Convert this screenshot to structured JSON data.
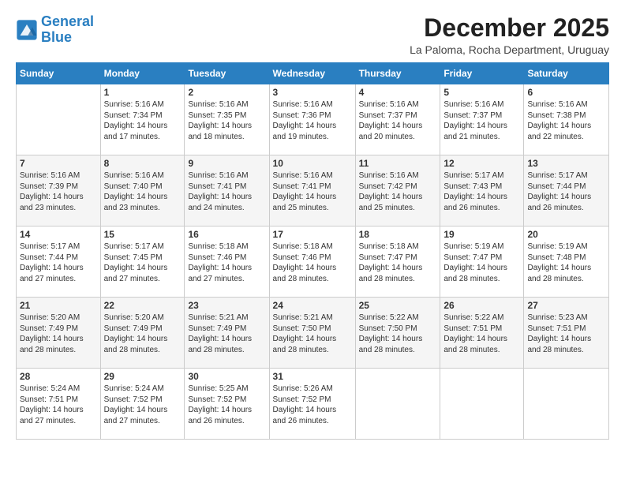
{
  "logo": {
    "line1": "General",
    "line2": "Blue"
  },
  "title": "December 2025",
  "subtitle": "La Paloma, Rocha Department, Uruguay",
  "days_header": [
    "Sunday",
    "Monday",
    "Tuesday",
    "Wednesday",
    "Thursday",
    "Friday",
    "Saturday"
  ],
  "weeks": [
    [
      {
        "day": "",
        "info": ""
      },
      {
        "day": "1",
        "info": "Sunrise: 5:16 AM\nSunset: 7:34 PM\nDaylight: 14 hours\nand 17 minutes."
      },
      {
        "day": "2",
        "info": "Sunrise: 5:16 AM\nSunset: 7:35 PM\nDaylight: 14 hours\nand 18 minutes."
      },
      {
        "day": "3",
        "info": "Sunrise: 5:16 AM\nSunset: 7:36 PM\nDaylight: 14 hours\nand 19 minutes."
      },
      {
        "day": "4",
        "info": "Sunrise: 5:16 AM\nSunset: 7:37 PM\nDaylight: 14 hours\nand 20 minutes."
      },
      {
        "day": "5",
        "info": "Sunrise: 5:16 AM\nSunset: 7:37 PM\nDaylight: 14 hours\nand 21 minutes."
      },
      {
        "day": "6",
        "info": "Sunrise: 5:16 AM\nSunset: 7:38 PM\nDaylight: 14 hours\nand 22 minutes."
      }
    ],
    [
      {
        "day": "7",
        "info": "Sunrise: 5:16 AM\nSunset: 7:39 PM\nDaylight: 14 hours\nand 23 minutes."
      },
      {
        "day": "8",
        "info": "Sunrise: 5:16 AM\nSunset: 7:40 PM\nDaylight: 14 hours\nand 23 minutes."
      },
      {
        "day": "9",
        "info": "Sunrise: 5:16 AM\nSunset: 7:41 PM\nDaylight: 14 hours\nand 24 minutes."
      },
      {
        "day": "10",
        "info": "Sunrise: 5:16 AM\nSunset: 7:41 PM\nDaylight: 14 hours\nand 25 minutes."
      },
      {
        "day": "11",
        "info": "Sunrise: 5:16 AM\nSunset: 7:42 PM\nDaylight: 14 hours\nand 25 minutes."
      },
      {
        "day": "12",
        "info": "Sunrise: 5:17 AM\nSunset: 7:43 PM\nDaylight: 14 hours\nand 26 minutes."
      },
      {
        "day": "13",
        "info": "Sunrise: 5:17 AM\nSunset: 7:44 PM\nDaylight: 14 hours\nand 26 minutes."
      }
    ],
    [
      {
        "day": "14",
        "info": "Sunrise: 5:17 AM\nSunset: 7:44 PM\nDaylight: 14 hours\nand 27 minutes."
      },
      {
        "day": "15",
        "info": "Sunrise: 5:17 AM\nSunset: 7:45 PM\nDaylight: 14 hours\nand 27 minutes."
      },
      {
        "day": "16",
        "info": "Sunrise: 5:18 AM\nSunset: 7:46 PM\nDaylight: 14 hours\nand 27 minutes."
      },
      {
        "day": "17",
        "info": "Sunrise: 5:18 AM\nSunset: 7:46 PM\nDaylight: 14 hours\nand 28 minutes."
      },
      {
        "day": "18",
        "info": "Sunrise: 5:18 AM\nSunset: 7:47 PM\nDaylight: 14 hours\nand 28 minutes."
      },
      {
        "day": "19",
        "info": "Sunrise: 5:19 AM\nSunset: 7:47 PM\nDaylight: 14 hours\nand 28 minutes."
      },
      {
        "day": "20",
        "info": "Sunrise: 5:19 AM\nSunset: 7:48 PM\nDaylight: 14 hours\nand 28 minutes."
      }
    ],
    [
      {
        "day": "21",
        "info": "Sunrise: 5:20 AM\nSunset: 7:49 PM\nDaylight: 14 hours\nand 28 minutes."
      },
      {
        "day": "22",
        "info": "Sunrise: 5:20 AM\nSunset: 7:49 PM\nDaylight: 14 hours\nand 28 minutes."
      },
      {
        "day": "23",
        "info": "Sunrise: 5:21 AM\nSunset: 7:49 PM\nDaylight: 14 hours\nand 28 minutes."
      },
      {
        "day": "24",
        "info": "Sunrise: 5:21 AM\nSunset: 7:50 PM\nDaylight: 14 hours\nand 28 minutes."
      },
      {
        "day": "25",
        "info": "Sunrise: 5:22 AM\nSunset: 7:50 PM\nDaylight: 14 hours\nand 28 minutes."
      },
      {
        "day": "26",
        "info": "Sunrise: 5:22 AM\nSunset: 7:51 PM\nDaylight: 14 hours\nand 28 minutes."
      },
      {
        "day": "27",
        "info": "Sunrise: 5:23 AM\nSunset: 7:51 PM\nDaylight: 14 hours\nand 28 minutes."
      }
    ],
    [
      {
        "day": "28",
        "info": "Sunrise: 5:24 AM\nSunset: 7:51 PM\nDaylight: 14 hours\nand 27 minutes."
      },
      {
        "day": "29",
        "info": "Sunrise: 5:24 AM\nSunset: 7:52 PM\nDaylight: 14 hours\nand 27 minutes."
      },
      {
        "day": "30",
        "info": "Sunrise: 5:25 AM\nSunset: 7:52 PM\nDaylight: 14 hours\nand 26 minutes."
      },
      {
        "day": "31",
        "info": "Sunrise: 5:26 AM\nSunset: 7:52 PM\nDaylight: 14 hours\nand 26 minutes."
      },
      {
        "day": "",
        "info": ""
      },
      {
        "day": "",
        "info": ""
      },
      {
        "day": "",
        "info": ""
      }
    ]
  ]
}
